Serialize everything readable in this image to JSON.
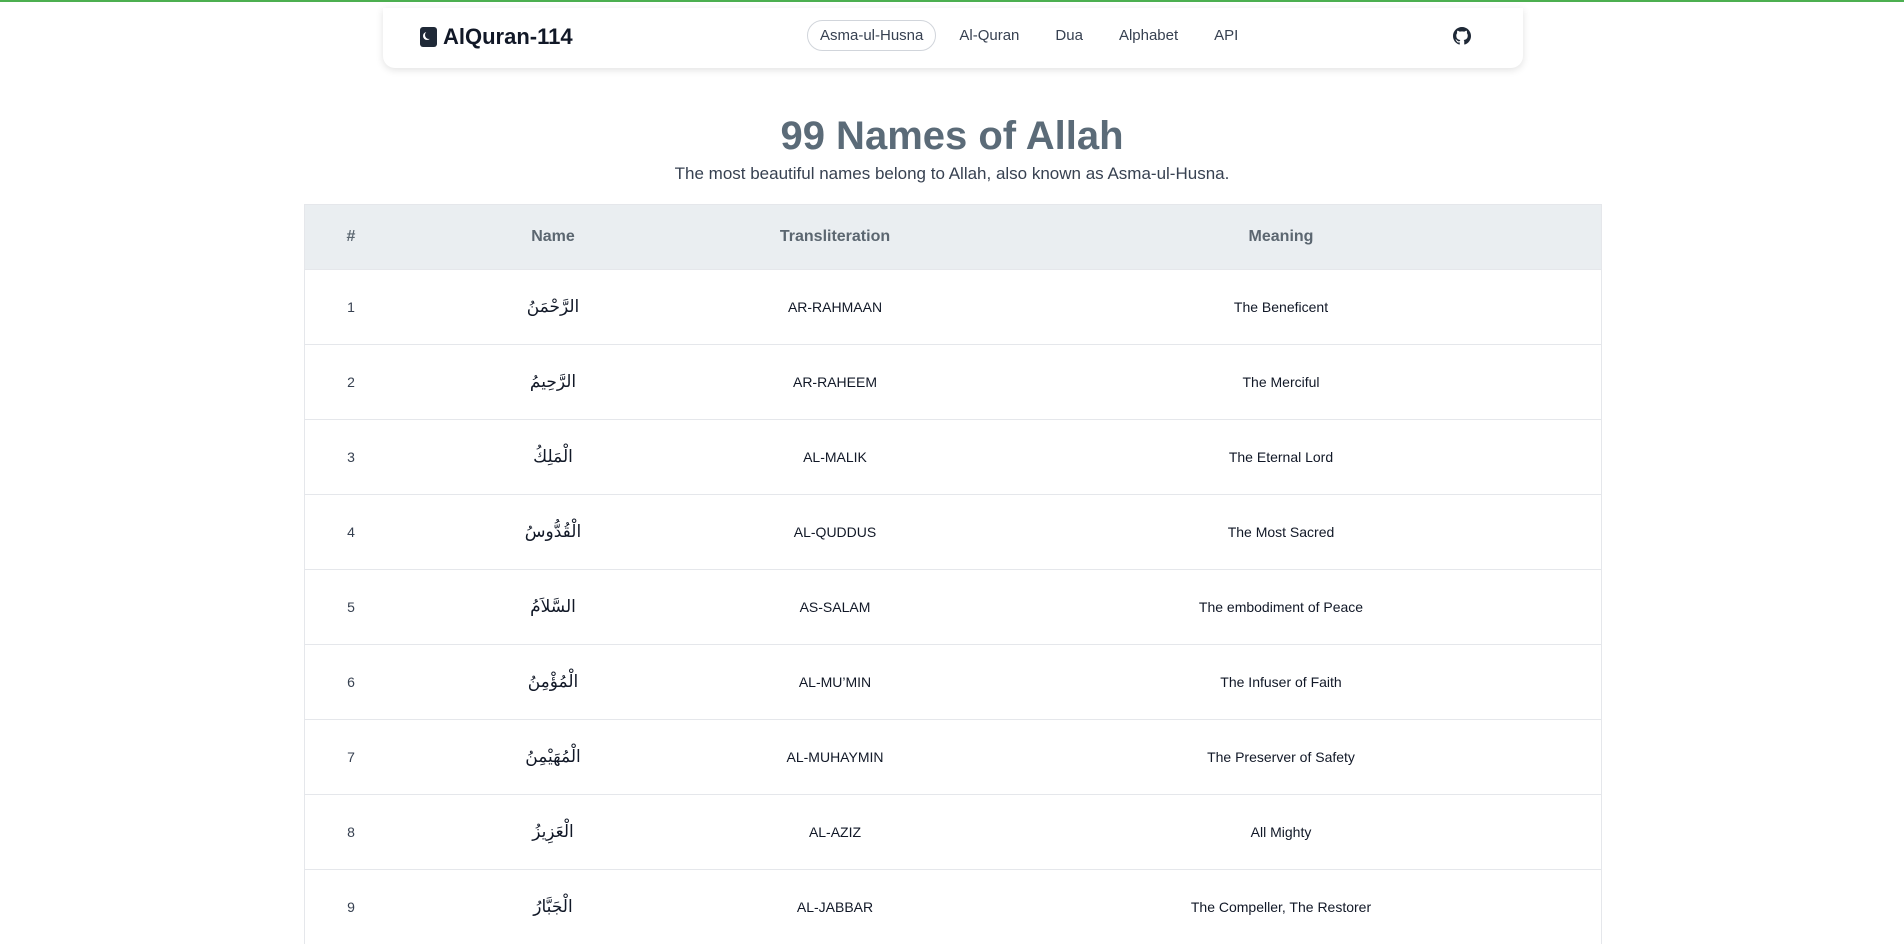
{
  "nav": {
    "brand": "AlQuran-114",
    "links": [
      "Asma-ul-Husna",
      "Al-Quran",
      "Dua",
      "Alphabet",
      "API"
    ],
    "active": "Asma-ul-Husna",
    "github_icon": "github-icon"
  },
  "header": {
    "title": "99 Names of Allah",
    "subtitle": "The most beautiful names belong to Allah, also known as Asma-ul-Husna."
  },
  "table": {
    "columns": [
      "#",
      "Name",
      "Transliteration",
      "Meaning"
    ],
    "rows": [
      {
        "num": "1",
        "name": "الرَّحْمَنُ",
        "translit": "AR-RAHMAAN",
        "meaning": "The Beneficent"
      },
      {
        "num": "2",
        "name": "الرَّحِيمُ",
        "translit": "AR-RAHEEM",
        "meaning": "The Merciful"
      },
      {
        "num": "3",
        "name": "الْمَلِكُ",
        "translit": "AL-MALIK",
        "meaning": "The Eternal Lord"
      },
      {
        "num": "4",
        "name": "الْقُدُّوسُ",
        "translit": "AL-QUDDUS",
        "meaning": "The Most Sacred"
      },
      {
        "num": "5",
        "name": "السَّلاَمُ",
        "translit": "AS-SALAM",
        "meaning": "The embodiment of Peace"
      },
      {
        "num": "6",
        "name": "الْمُؤْمِنُ",
        "translit": "AL-MU’MIN",
        "meaning": "The Infuser of Faith"
      },
      {
        "num": "7",
        "name": "الْمُهَيْمِنُ",
        "translit": "AL-MUHAYMIN",
        "meaning": "The Preserver of Safety"
      },
      {
        "num": "8",
        "name": "الْعَزِيزُ",
        "translit": "AL-AZIZ",
        "meaning": "All Mighty"
      },
      {
        "num": "9",
        "name": "الْجَبَّارُ",
        "translit": "AL-JABBAR",
        "meaning": "The Compeller, The Restorer"
      }
    ]
  },
  "colors": {
    "top_line": "#4caf50",
    "title": "#5b6b78",
    "table_header_bg": "#eaeef1"
  }
}
